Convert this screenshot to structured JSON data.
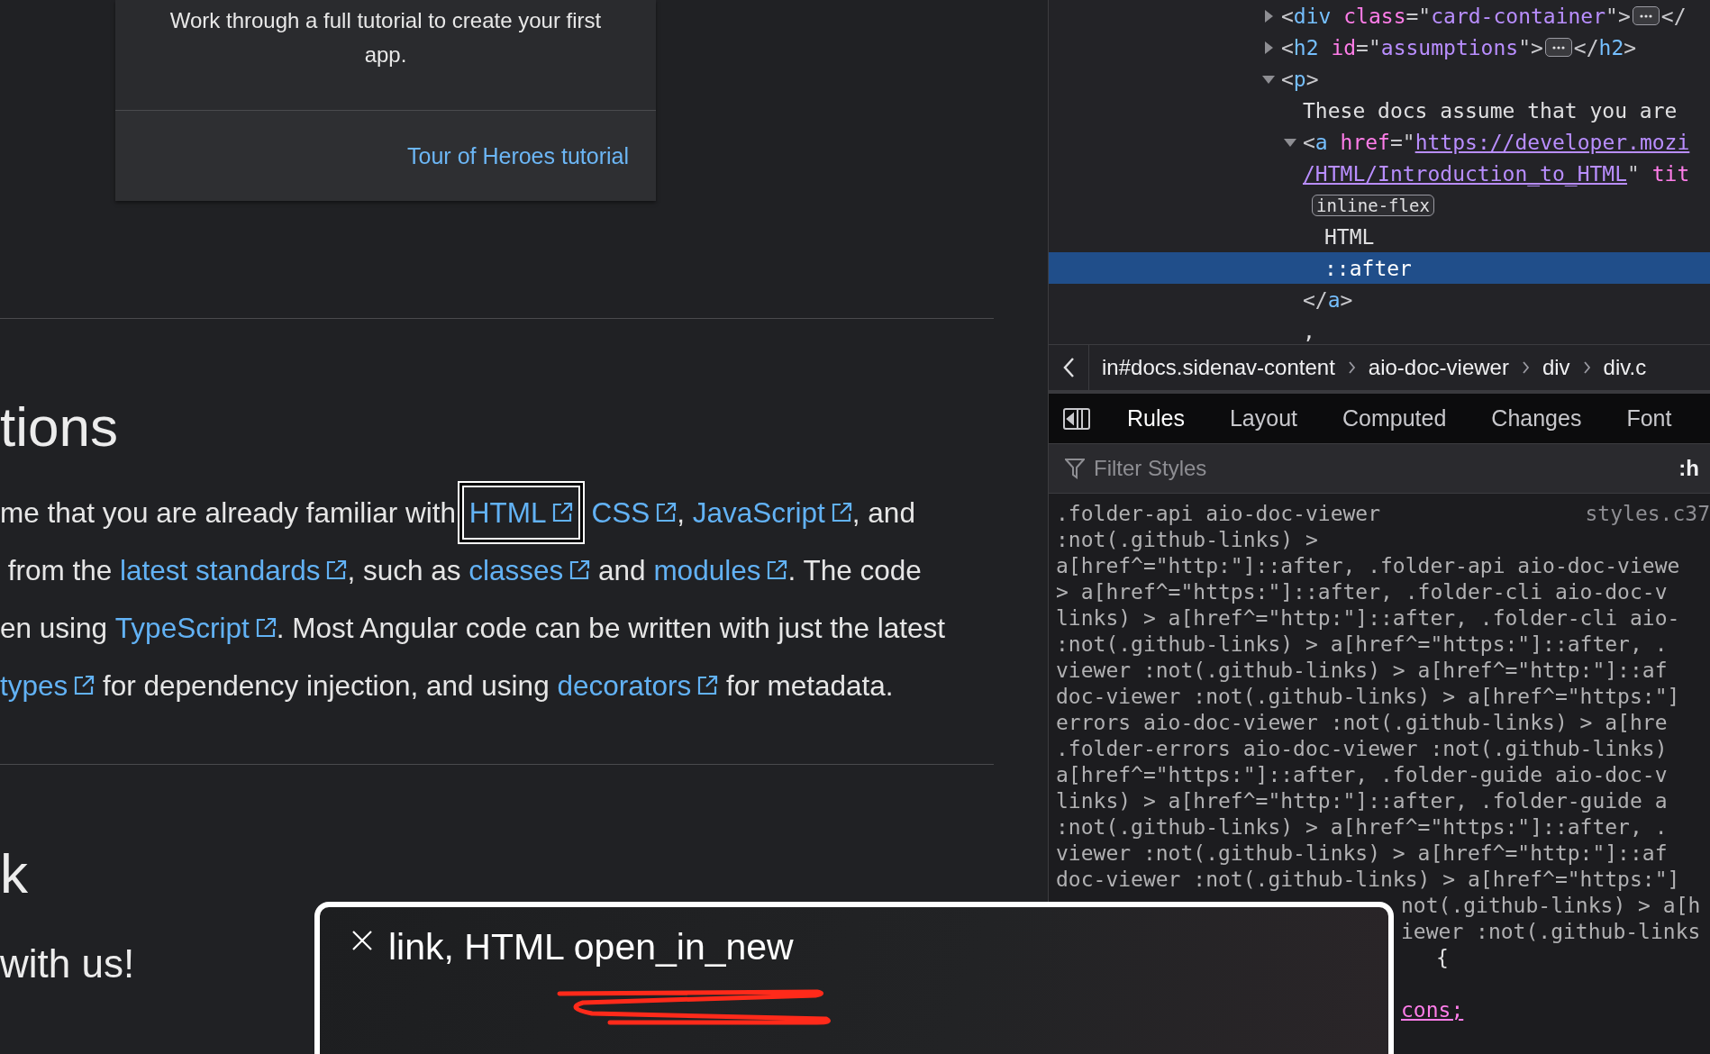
{
  "page": {
    "card": {
      "text_lines": [
        "Work through a full tutorial to create your first",
        "app."
      ],
      "link": "Tour of Heroes tutorial"
    },
    "sections": [
      {
        "heading": "tions",
        "lines": [
          [
            {
              "kind": "text",
              "text": "me that you are already familiar with "
            },
            {
              "kind": "link",
              "text": "HTML",
              "focused": true
            },
            {
              "kind": "link",
              "text": "CSS",
              "focused": false
            },
            {
              "kind": "text",
              "text": ", "
            },
            {
              "kind": "link",
              "text": "JavaScript",
              "focused": false
            },
            {
              "kind": "text",
              "text": ", and"
            }
          ],
          [
            {
              "kind": "text",
              "text": " from the "
            },
            {
              "kind": "link",
              "text": "latest standards",
              "focused": false
            },
            {
              "kind": "text",
              "text": ", such as "
            },
            {
              "kind": "link",
              "text": "classes",
              "focused": false
            },
            {
              "kind": "text",
              "text": " and "
            },
            {
              "kind": "link",
              "text": "modules",
              "focused": false
            },
            {
              "kind": "text",
              "text": ". The code"
            }
          ],
          [
            {
              "kind": "text",
              "text": "en using "
            },
            {
              "kind": "link",
              "text": "TypeScript",
              "focused": false
            },
            {
              "kind": "text",
              "text": ". Most Angular code can be written with just the latest"
            }
          ],
          [
            {
              "kind": "link",
              "text": "types",
              "focused": false
            },
            {
              "kind": "text",
              "text": " for dependency injection, and using "
            },
            {
              "kind": "link",
              "text": "decorators",
              "focused": false
            },
            {
              "kind": "text",
              "text": " for metadata."
            }
          ]
        ]
      },
      {
        "heading": "k",
        "subheading": "with us!"
      }
    ]
  },
  "devtools": {
    "markup": [
      {
        "expanded": false,
        "selected": false,
        "lines": [
          [
            {
              "kind": "punct",
              "text": "<"
            },
            {
              "kind": "tag",
              "text": "div"
            },
            {
              "kind": "attr",
              "text": " class"
            },
            {
              "kind": "punct",
              "text": "=\""
            },
            {
              "kind": "value",
              "text": "card-container"
            },
            {
              "kind": "punct",
              "text": "\">"
            },
            {
              "kind": "more"
            },
            {
              "kind": "punct",
              "text": "</"
            }
          ]
        ]
      },
      {
        "expanded": false,
        "selected": false,
        "lines": [
          [
            {
              "kind": "punct",
              "text": "<"
            },
            {
              "kind": "tag",
              "text": "h2"
            },
            {
              "kind": "attr",
              "text": " id"
            },
            {
              "kind": "punct",
              "text": "=\""
            },
            {
              "kind": "value",
              "text": "assumptions"
            },
            {
              "kind": "punct",
              "text": "\">"
            },
            {
              "kind": "more"
            },
            {
              "kind": "punct",
              "text": "</"
            },
            {
              "kind": "tag",
              "text": "h2"
            },
            {
              "kind": "punct",
              "text": ">"
            }
          ]
        ]
      },
      {
        "expanded": true,
        "selected": false,
        "lines": [
          [
            {
              "kind": "punct",
              "text": "<"
            },
            {
              "kind": "tag",
              "text": "p"
            },
            {
              "kind": "punct",
              "text": ">"
            }
          ]
        ],
        "children": [
          {
            "selected": false,
            "lines": [
              [
                {
                  "kind": "text",
                  "text": "These docs assume that you are"
                }
              ]
            ]
          },
          {
            "expanded": true,
            "selected": false,
            "lines": [
              [
                {
                  "kind": "punct",
                  "text": "<"
                },
                {
                  "kind": "tag",
                  "text": "a"
                },
                {
                  "kind": "attr",
                  "text": " href"
                },
                {
                  "kind": "punct",
                  "text": "=\""
                },
                {
                  "kind": "link",
                  "text": "https://developer.mozi"
                }
              ],
              [
                {
                  "kind": "link",
                  "text": "/HTML/Introduction_to_HTML"
                },
                {
                  "kind": "punct",
                  "text": "\""
                },
                {
                  "kind": "attr",
                  "text": " tit"
                }
              ],
              [
                {
                  "kind": "badge",
                  "text": "inline-flex"
                }
              ]
            ],
            "children": [
              {
                "selected": false,
                "lines": [
                  [
                    {
                      "kind": "text",
                      "text": "HTML"
                    }
                  ]
                ]
              },
              {
                "selected": true,
                "lines": [
                  [
                    {
                      "kind": "text",
                      "text": "::after"
                    }
                  ]
                ]
              }
            ],
            "closing": [
              {
                "kind": "punct",
                "text": "</"
              },
              {
                "kind": "tag",
                "text": "a"
              },
              {
                "kind": "punct",
                "text": ">"
              }
            ]
          },
          {
            "selected": false,
            "lines": [
              [
                {
                  "kind": "text",
                  "text": ","
                }
              ]
            ]
          }
        ]
      }
    ],
    "breadcrumbs": [
      "in#docs.sidenav-content",
      "aio-doc-viewer",
      "div",
      "div.c"
    ],
    "tabs": [
      {
        "label": "Rules",
        "selected": true
      },
      {
        "label": "Layout",
        "selected": false
      },
      {
        "label": "Computed",
        "selected": false
      },
      {
        "label": "Changes",
        "selected": false
      },
      {
        "label": "Font",
        "selected": false
      }
    ],
    "filter": {
      "placeholder": "Filter Styles",
      "pseudo_toggle": ":h"
    },
    "rule_source": "styles.c37",
    "rule_lines": [
      ".folder-api aio-doc-viewer",
      ":not(.github-links) >",
      "a[href^=\"http:\"]::after, .folder-api aio-doc-viewe",
      "> a[href^=\"https:\"]::after, .folder-cli aio-doc-v",
      "links) > a[href^=\"http:\"]::after, .folder-cli aio-",
      ":not(.github-links) > a[href^=\"https:\"]::after, .",
      "viewer :not(.github-links) > a[href^=\"http:\"]::af",
      "doc-viewer :not(.github-links) > a[href^=\"https:\"]",
      "errors aio-doc-viewer :not(.github-links) > a[hre",
      ".folder-errors aio-doc-viewer :not(.github-links)",
      "a[href^=\"https:\"]::after, .folder-guide aio-doc-v",
      "links) > a[href^=\"http:\"]::after, .folder-guide a",
      ":not(.github-links) > a[href^=\"https:\"]::after, .",
      "viewer :not(.github-links) > a[href^=\"http:\"]::af",
      "doc-viewer :not(.github-links) > a[href^=\"https:\"]"
    ],
    "rule_lines_beside_popup": [
      {
        "kind": "selector",
        "text": "not(.github-links) > a[h"
      },
      {
        "kind": "selector",
        "text": "iewer :not(.github-links"
      },
      {
        "kind": "brace",
        "text": "{"
      },
      {
        "kind": "value",
        "text": "cons;"
      }
    ]
  },
  "popup": {
    "text": "link, HTML open_in_new"
  }
}
